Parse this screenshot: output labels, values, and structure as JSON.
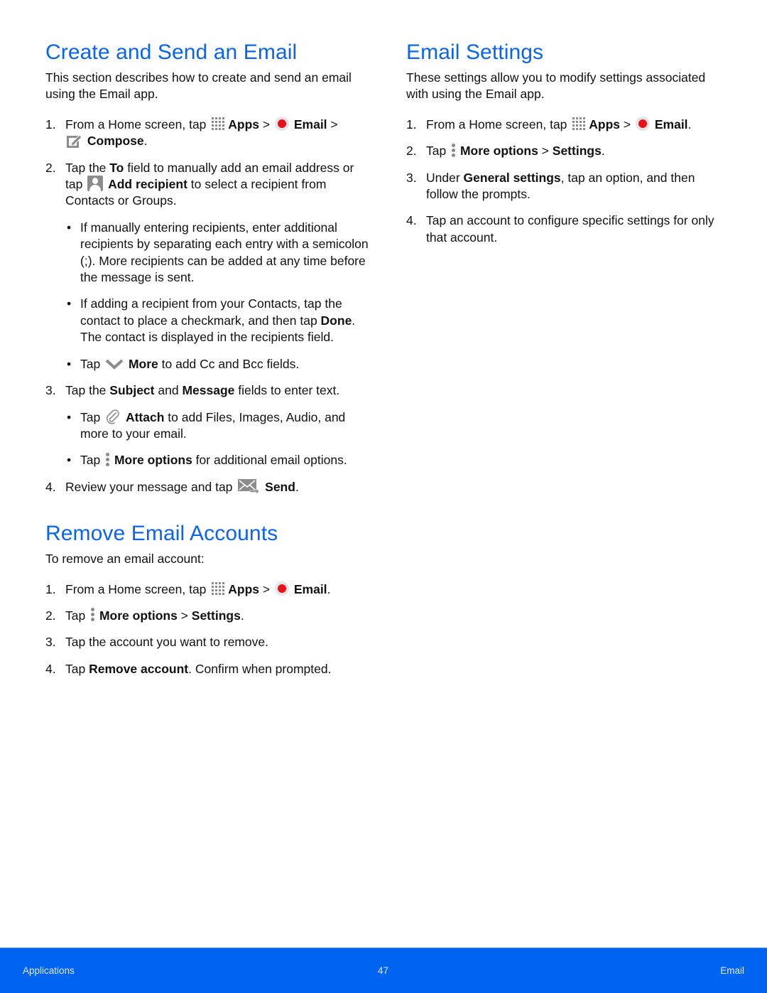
{
  "left": {
    "create": {
      "title": "Create and Send an Email",
      "intro": "This section describes how to create and send an email using the Email app.",
      "steps": [
        {
          "num": "1.",
          "t1": "From a Home screen, tap ",
          "apps": "Apps",
          "sep1": " > ",
          "email": "Email",
          "sep2": " >",
          "compose": "Compose",
          "end": "."
        },
        {
          "num": "2.",
          "t1": "Tap the ",
          "to": "To",
          "t2": " field to manually add an email address or tap ",
          "add": "Add recipient",
          "t3": " to select a recipient from Contacts or Groups."
        },
        {
          "num": "3.",
          "t1": "Tap the ",
          "subject": "Subject",
          "t2": " and ",
          "message": "Message",
          "t3": " fields to enter text."
        },
        {
          "num": "4.",
          "t1": "Review your message and tap ",
          "send": "Send",
          "end": "."
        }
      ],
      "bullets_step2": [
        {
          "dot": "•",
          "text": "If manually entering recipients, enter additional recipients by separating each entry with a semicolon (;). More recipients can be added at any time before the message is sent."
        },
        {
          "dot": "•",
          "t1": "If adding a recipient from your Contacts, tap the contact to place a checkmark, and then tap ",
          "done": "Done",
          "t2": ". The contact is displayed in the recipients field."
        },
        {
          "dot": "•",
          "t1": "Tap ",
          "more": "More",
          "t2": " to add Cc and Bcc fields."
        }
      ],
      "bullets_step3": [
        {
          "dot": "•",
          "t1": "Tap ",
          "attach": "Attach",
          "t2": " to add Files, Images, Audio, and more to your email."
        },
        {
          "dot": "•",
          "t1": "Tap ",
          "more_options": "More options",
          "t2": " for additional email options."
        }
      ]
    },
    "remove": {
      "title": "Remove Email Accounts",
      "intro": "To remove an email account:",
      "steps": [
        {
          "num": "1.",
          "t1": "From a Home screen, tap ",
          "apps": "Apps",
          "sep1": " > ",
          "email": "Email",
          "end": "."
        },
        {
          "num": "2.",
          "t1": "Tap ",
          "more_options": "More options",
          "sep": " > ",
          "settings": "Settings",
          "end": "."
        },
        {
          "num": "3.",
          "text": "Tap the account you want to remove."
        },
        {
          "num": "4.",
          "t1": "Tap ",
          "remove": "Remove account",
          "t2": ". Confirm when prompted."
        }
      ]
    }
  },
  "right": {
    "settings": {
      "title": "Email Settings",
      "intro": "These settings allow you to modify settings associated with using the Email app.",
      "steps": [
        {
          "num": "1.",
          "t1": "From a Home screen, tap ",
          "apps": "Apps",
          "sep1": " > ",
          "email": "Email",
          "end": "."
        },
        {
          "num": "2.",
          "t1": "Tap ",
          "more_options": "More options",
          "sep": " > ",
          "settings": "Settings",
          "end": "."
        },
        {
          "num": "3.",
          "t1": "Under ",
          "general": "General settings",
          "t2": ", tap an option, and then follow the prompts."
        },
        {
          "num": "4.",
          "text": "Tap an account to configure specific settings for only that account."
        }
      ]
    }
  },
  "footer": {
    "section": "Applications",
    "page": "47",
    "chapter": "Email",
    "bg_color": "#0064f0"
  },
  "accent_color": "#0a64f0",
  "icons": [
    "apps-grid-icon",
    "email-app-icon",
    "compose-icon",
    "add-recipient-icon",
    "chevron-down-icon",
    "attach-icon",
    "more-options-icon",
    "send-icon"
  ]
}
